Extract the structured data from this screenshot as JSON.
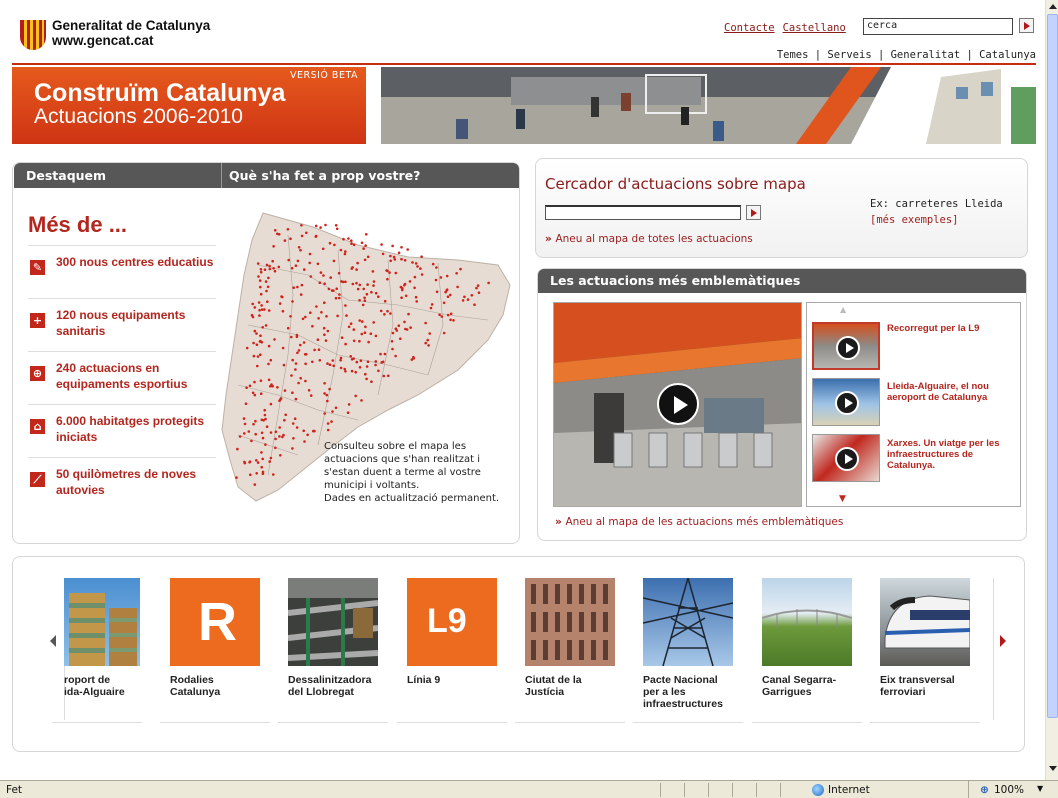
{
  "header": {
    "logo_line1": "Generalitat de Catalunya",
    "logo_line2": "www.gencat.cat",
    "contact_link": "Contacte",
    "language_link": "Castellano",
    "search_value": "cerca",
    "top_nav": "Temes | Serveis | Generalitat | Catalunya"
  },
  "banner": {
    "beta": "VERSIÓ BETA",
    "title": "Construïm Catalunya",
    "subtitle": "Actuacions 2006-2010"
  },
  "left_panel": {
    "tab1": "Destaquem",
    "tab2": "Què s'ha fet a prop vostre?",
    "heading": "Més de ...",
    "features": [
      {
        "icon": "pencil-icon",
        "glyph": "✎",
        "text": "300 nous centres educatius"
      },
      {
        "icon": "cross-icon",
        "glyph": "+",
        "text": "120 nous equipaments sanitaris"
      },
      {
        "icon": "ball-icon",
        "glyph": "⊕",
        "text": "240 actuacions en equipaments esportius"
      },
      {
        "icon": "house-icon",
        "glyph": "⌂",
        "text": "6.000 habitatges protegits iniciats"
      },
      {
        "icon": "road-icon",
        "glyph": "⟋",
        "text": "50 quilòmetres de noves autovies"
      }
    ],
    "map_caption": "Consulteu sobre el mapa les actuacions que s'han realitzat i s'estan duent a terme al vostre municipi i voltants.\nDades en actualització permanent."
  },
  "cercador": {
    "title": "Cercador d'actuacions sobre mapa",
    "example_line": "Ex: carreteres Lleida",
    "more_examples": "[més exemples]",
    "all_link": "Aneu al mapa de totes les actuacions"
  },
  "emblematiques": {
    "title": "Les actuacions més emblemàtiques",
    "items": [
      {
        "label": "Recorregut per la L9"
      },
      {
        "label": "Lleida-Alguaire, el nou aeroport de Catalunya"
      },
      {
        "label": "Xarxes. Un viatge per les infraestructures de Catalunya."
      }
    ],
    "map_link": "Aneu al mapa de les actuacions més emblemàtiques"
  },
  "carousel": {
    "items": [
      {
        "label": "roport de\nida-Alguaire"
      },
      {
        "label": "Rodalies\nCatalunya",
        "thumb_text": "R"
      },
      {
        "label": "Dessalinitzadora\ndel Llobregat"
      },
      {
        "label": "Línia 9",
        "thumb_text": "L9"
      },
      {
        "label": "Ciutat de la\nJustícia"
      },
      {
        "label": "Pacte Nacional\nper a les\ninfraestructures"
      },
      {
        "label": "Canal Segarra-\nGarrigues"
      },
      {
        "label": "Eix transversal\nferroviari"
      }
    ]
  },
  "statusbar": {
    "status": "Fet",
    "zone": "Internet",
    "zoom": "100%"
  },
  "colors": {
    "accent": "#b3261e",
    "banner": "#d9411a",
    "bar": "#575757"
  }
}
